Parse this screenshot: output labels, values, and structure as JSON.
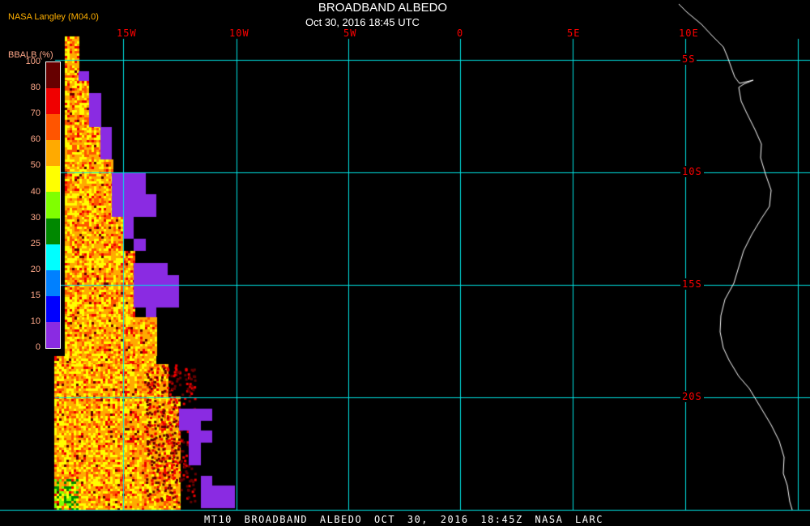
{
  "header": {
    "title": "BROADBAND ALBEDO",
    "subtitle": "Oct 30, 2016 18:45 UTC",
    "source": "NASA Langley (M04.0)"
  },
  "longitude_labels": [
    "15W",
    "10W",
    "5W",
    "0",
    "5E",
    "10E"
  ],
  "latitude_labels": [
    "5S",
    "10S",
    "15S",
    "20S"
  ],
  "colorbar": {
    "title": "BBALB (%)",
    "ticks": [
      "100",
      "80",
      "70",
      "60",
      "50",
      "40",
      "30",
      "25",
      "20",
      "15",
      "10",
      "0"
    ],
    "colors": [
      "#660000",
      "#f00000",
      "#ff5500",
      "#ffaa00",
      "#ffff00",
      "#80ff00",
      "#008800",
      "#00ffff",
      "#0080ff",
      "#0000ff",
      "#8a2be2"
    ]
  },
  "footer": "MT10  BROADBAND ALBEDO   OCT 30, 2016 18:45Z   NASA LARC",
  "colors": {
    "grid": "#00e5e5",
    "coast": "#ffffff",
    "label": "#ff0000",
    "nodata": "#8a2be2"
  }
}
